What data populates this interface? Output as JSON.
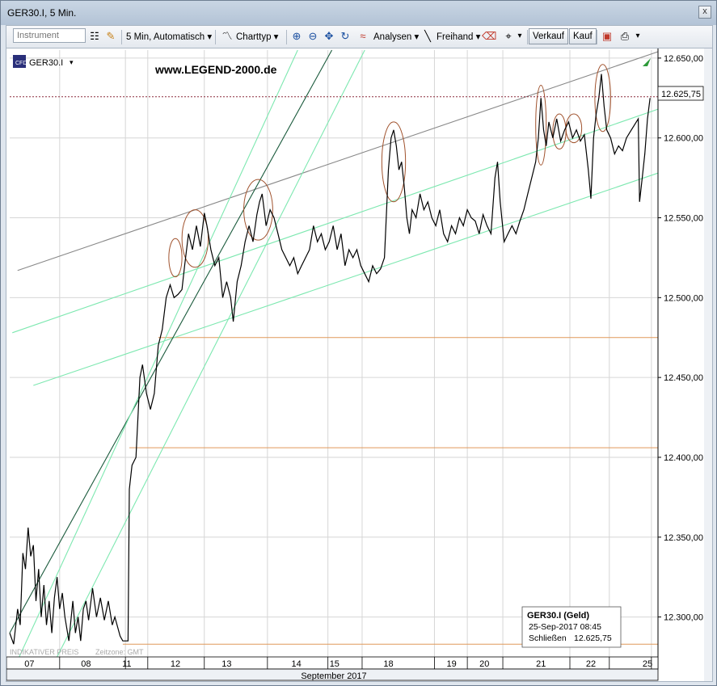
{
  "window": {
    "title": "GER30.I, 5 Min.",
    "close_glyph": "x"
  },
  "toolbar": {
    "instrument_placeholder": "Instrument",
    "timeframe": "5 Min,",
    "scale_mode": "Automatisch",
    "chart_type": "Charttyp",
    "analyses": "Analysen",
    "freehand": "Freihand",
    "sell": "Verkauf",
    "buy": "Kauf",
    "dropdown_glyph": "▾"
  },
  "chart_header": {
    "symbol": "GER30.I",
    "symbol_dropdown": "▾",
    "watermark_url": "www.LEGEND-2000.de",
    "indicator_label": "INDIKATIVER PREIS",
    "timezone": "Zeitzone: GMT"
  },
  "chart_data": {
    "type": "line",
    "title": "",
    "xlabel": "",
    "ylabel": "",
    "x_ticks": [
      "07",
      "08",
      "11",
      "12",
      "13",
      "14",
      "15",
      "18",
      "19",
      "20",
      "21",
      "22",
      "25"
    ],
    "x_month_label": "September 2017",
    "y_ticks": [
      "12.650,00",
      "12.600,00",
      "12.550,00",
      "12.500,00",
      "12.450,00",
      "12.400,00",
      "12.350,00",
      "12.300,00"
    ],
    "ylim": [
      12275,
      12655
    ],
    "current_price_label": "12.625,75",
    "current_price": 12625.75,
    "horizontal_levels": [
      12475,
      12406,
      12283
    ],
    "series": [
      {
        "values": [
          [
            0,
            12290
          ],
          [
            0.3,
            12283
          ],
          [
            0.6,
            12305
          ],
          [
            0.8,
            12295
          ],
          [
            1.0,
            12340
          ],
          [
            1.2,
            12330
          ],
          [
            1.4,
            12356
          ],
          [
            1.6,
            12338
          ],
          [
            1.8,
            12345
          ],
          [
            2.0,
            12310
          ],
          [
            2.2,
            12330
          ],
          [
            2.4,
            12300
          ],
          [
            2.6,
            12320
          ],
          [
            2.8,
            12295
          ],
          [
            3.0,
            12310
          ],
          [
            3.2,
            12290
          ],
          [
            3.4,
            12312
          ],
          [
            3.6,
            12325
          ],
          [
            3.8,
            12305
          ],
          [
            4.0,
            12315
          ],
          [
            4.2,
            12300
          ],
          [
            4.5,
            12285
          ],
          [
            4.8,
            12310
          ],
          [
            5.0,
            12290
          ],
          [
            5.2,
            12300
          ],
          [
            5.4,
            12285
          ],
          [
            5.6,
            12305
          ],
          [
            5.8,
            12310
          ],
          [
            6.0,
            12298
          ],
          [
            6.3,
            12318
          ],
          [
            6.6,
            12300
          ],
          [
            6.9,
            12312
          ],
          [
            7.2,
            12298
          ],
          [
            7.5,
            12310
          ],
          [
            7.8,
            12295
          ],
          [
            8.0,
            12300
          ],
          [
            8.4,
            12288
          ],
          [
            8.6,
            12285
          ],
          [
            9.0,
            12285
          ],
          [
            9.1,
            12380
          ],
          [
            9.3,
            12395
          ],
          [
            9.6,
            12400
          ],
          [
            9.9,
            12450
          ],
          [
            10.1,
            12458
          ],
          [
            10.4,
            12440
          ],
          [
            10.7,
            12430
          ],
          [
            11.0,
            12440
          ],
          [
            11.3,
            12470
          ],
          [
            11.6,
            12480
          ],
          [
            11.9,
            12500
          ],
          [
            12.2,
            12508
          ],
          [
            12.5,
            12500
          ],
          [
            12.8,
            12502
          ],
          [
            13.1,
            12505
          ],
          [
            13.3,
            12520
          ],
          [
            13.6,
            12540
          ],
          [
            13.9,
            12530
          ],
          [
            14.2,
            12545
          ],
          [
            14.5,
            12532
          ],
          [
            14.8,
            12553
          ],
          [
            15.0,
            12545
          ],
          [
            15.3,
            12530
          ],
          [
            15.6,
            12520
          ],
          [
            15.9,
            12525
          ],
          [
            16.2,
            12500
          ],
          [
            16.5,
            12510
          ],
          [
            16.8,
            12500
          ],
          [
            17.0,
            12485
          ],
          [
            17.3,
            12510
          ],
          [
            17.6,
            12520
          ],
          [
            17.9,
            12535
          ],
          [
            18.2,
            12545
          ],
          [
            18.5,
            12535
          ],
          [
            18.8,
            12552
          ],
          [
            19.0,
            12560
          ],
          [
            19.2,
            12565
          ],
          [
            19.5,
            12545
          ],
          [
            19.8,
            12555
          ],
          [
            20.1,
            12550
          ],
          [
            20.4,
            12540
          ],
          [
            20.7,
            12530
          ],
          [
            21.0,
            12525
          ],
          [
            21.3,
            12520
          ],
          [
            21.6,
            12525
          ],
          [
            21.9,
            12515
          ],
          [
            22.2,
            12520
          ],
          [
            22.5,
            12525
          ],
          [
            22.8,
            12530
          ],
          [
            23.1,
            12545
          ],
          [
            23.4,
            12535
          ],
          [
            23.7,
            12540
          ],
          [
            24.0,
            12530
          ],
          [
            24.3,
            12535
          ],
          [
            24.6,
            12545
          ],
          [
            24.9,
            12530
          ],
          [
            25.2,
            12540
          ],
          [
            25.5,
            12520
          ],
          [
            25.8,
            12530
          ],
          [
            26.1,
            12525
          ],
          [
            26.4,
            12530
          ],
          [
            26.7,
            12520
          ],
          [
            27.0,
            12515
          ],
          [
            27.3,
            12510
          ],
          [
            27.6,
            12520
          ],
          [
            27.9,
            12515
          ],
          [
            28.2,
            12518
          ],
          [
            28.5,
            12525
          ],
          [
            28.8,
            12580
          ],
          [
            29.0,
            12600
          ],
          [
            29.2,
            12605
          ],
          [
            29.4,
            12595
          ],
          [
            29.6,
            12580
          ],
          [
            29.8,
            12585
          ],
          [
            30.0,
            12570
          ],
          [
            30.2,
            12550
          ],
          [
            30.4,
            12540
          ],
          [
            30.6,
            12555
          ],
          [
            30.9,
            12550
          ],
          [
            31.2,
            12565
          ],
          [
            31.5,
            12555
          ],
          [
            31.8,
            12560
          ],
          [
            32.1,
            12550
          ],
          [
            32.4,
            12545
          ],
          [
            32.7,
            12555
          ],
          [
            33.0,
            12540
          ],
          [
            33.3,
            12535
          ],
          [
            33.6,
            12545
          ],
          [
            33.9,
            12540
          ],
          [
            34.2,
            12550
          ],
          [
            34.5,
            12545
          ],
          [
            34.8,
            12555
          ],
          [
            35.1,
            12550
          ],
          [
            35.4,
            12548
          ],
          [
            35.7,
            12540
          ],
          [
            36.0,
            12552
          ],
          [
            36.3,
            12545
          ],
          [
            36.6,
            12540
          ],
          [
            36.9,
            12575
          ],
          [
            37.1,
            12585
          ],
          [
            37.3,
            12560
          ],
          [
            37.6,
            12535
          ],
          [
            37.9,
            12540
          ],
          [
            38.2,
            12545
          ],
          [
            38.5,
            12540
          ],
          [
            38.8,
            12548
          ],
          [
            39.1,
            12555
          ],
          [
            39.4,
            12565
          ],
          [
            39.7,
            12575
          ],
          [
            40.0,
            12585
          ],
          [
            40.2,
            12600
          ],
          [
            40.4,
            12625
          ],
          [
            40.6,
            12605
          ],
          [
            40.8,
            12595
          ],
          [
            41.0,
            12610
          ],
          [
            41.3,
            12600
          ],
          [
            41.6,
            12612
          ],
          [
            41.9,
            12598
          ],
          [
            42.2,
            12605
          ],
          [
            42.5,
            12610
          ],
          [
            42.8,
            12600
          ],
          [
            43.1,
            12605
          ],
          [
            43.4,
            12598
          ],
          [
            43.7,
            12602
          ],
          [
            44.0,
            12580
          ],
          [
            44.2,
            12562
          ],
          [
            44.4,
            12600
          ],
          [
            44.6,
            12615
          ],
          [
            44.8,
            12625
          ],
          [
            45.0,
            12640
          ],
          [
            45.2,
            12620
          ],
          [
            45.4,
            12605
          ],
          [
            45.7,
            12600
          ],
          [
            46.0,
            12590
          ],
          [
            46.3,
            12595
          ],
          [
            46.6,
            12592
          ],
          [
            46.9,
            12600
          ],
          [
            47.2,
            12604
          ],
          [
            47.5,
            12608
          ],
          [
            47.8,
            12612
          ],
          [
            47.9,
            12560
          ],
          [
            48.1,
            12575
          ],
          [
            48.3,
            12590
          ],
          [
            48.5,
            12612
          ],
          [
            48.7,
            12625
          ]
        ]
      }
    ]
  },
  "info_box": {
    "title": "GER30.I (Geld)",
    "datetime": "25-Sep-2017 08:45",
    "close_label": "Schließen",
    "close_value": "12.625,75"
  },
  "colors": {
    "price_line": "#000000",
    "trend_green": "#7de8b0",
    "trend_dark_green": "#1a5a3c",
    "trend_gray": "#888888",
    "horizontal_orange": "#e0995a",
    "ellipse_brown": "#a0522d",
    "current_price_line": "#8b2b3c"
  }
}
